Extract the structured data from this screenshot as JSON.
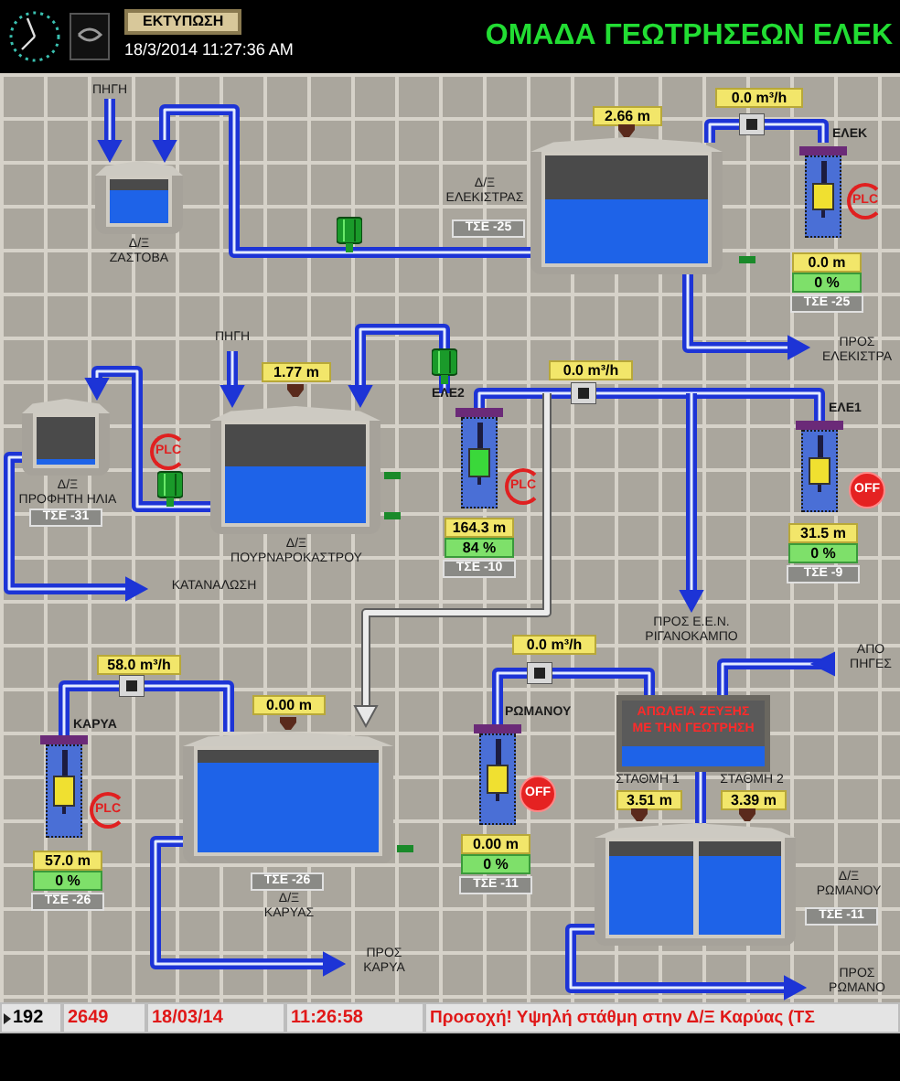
{
  "header": {
    "print_button": "ΕΚΤΥΠΩΣΗ",
    "datetime": "18/3/2014 11:27:36 AM",
    "title": "ΟΜΑΔΑ ΓΕΩΤΡΗΣΕΩΝ ΕΛΕΚ"
  },
  "tanks": [
    {
      "kind": "single",
      "label": "Δ/Ξ\nΖΑΣΤΟΒΑ",
      "level": 0.75
    },
    {
      "kind": "single",
      "label": "Δ/Ξ\nΕΛΕΚΙΣΤΡΑΣ",
      "reading": "2.66 m",
      "tag": "ΤΣΕ -25",
      "level": 0.6
    },
    {
      "kind": "single",
      "label": "Δ/Ξ\nΠΡΟΦΗΤΗ ΗΛΙΑ",
      "tag": "ΤΣΕ -31",
      "level": 0.12
    },
    {
      "kind": "single",
      "label": "Δ/Ξ\nΠΟΥΡΝΑΡΟΚΑΣΤΡΟΥ",
      "reading": "1.77 m",
      "level": 0.58
    },
    {
      "kind": "single",
      "label": "Δ/Ξ\nΚΑΡΥΑΣ",
      "reading": "0.00 m",
      "tag": "ΤΣΕ -26",
      "level": 0.88
    },
    {
      "kind": "split",
      "label": "Δ/Ξ\nΡΩΜΑΝΟΥ",
      "tag": "ΤΣΕ -11",
      "gauges": [
        {
          "label": "ΣΤΑΘΜΗ 1",
          "reading": "3.51 m",
          "level": 0.85
        },
        {
          "label": "ΣΤΑΘΜΗ 2",
          "reading": "3.39 m",
          "level": 0.85
        }
      ]
    }
  ],
  "pumps": [
    {
      "name": "ΕΛΕΚ",
      "running": false,
      "mode": {
        "kind": "auto",
        "label": "PLC"
      },
      "depth": "0.0 m",
      "output": "0 %",
      "tag": "ΤΣΕ -25"
    },
    {
      "name": "ΕΛΕ2",
      "running": true,
      "mode": {
        "kind": "auto",
        "label": "PLC"
      },
      "depth": "164.3 m",
      "output": "84 %",
      "tag": "ΤΣΕ -10"
    },
    {
      "name": "ΕΛΕ1",
      "running": false,
      "mode": {
        "kind": "off",
        "label": "OFF"
      },
      "depth": "31.5 m",
      "output": "0 %",
      "tag": "ΤΣΕ -9"
    },
    {
      "name": "ΚΑΡΥΑ",
      "running": false,
      "mode": {
        "kind": "auto",
        "label": "PLC"
      },
      "depth": "57.0 m",
      "output": "0 %",
      "tag": "ΤΣΕ -26"
    },
    {
      "name": "ΡΩΜΑΝΟΥ",
      "running": false,
      "mode": {
        "kind": "off",
        "label": "OFF"
      },
      "depth": "0.00 m",
      "output": "0 %",
      "tag": "ΤΣΕ -11"
    }
  ],
  "flow_meters": [
    {
      "reading": "0.0 m³/h"
    },
    {
      "reading": "0.0 m³/h"
    },
    {
      "reading": "58.0 m³/h"
    },
    {
      "reading": "0.0 m³/h"
    }
  ],
  "valve_mode": {
    "kind": "auto",
    "label": "PLC"
  },
  "alarm": {
    "text": "ΑΠΩΛΕΙΑ ΖΕΥΞΗΣ\nΜΕ ΤΗΝ ΓΕΩΤΡΗΣΗ",
    "level": 0.3
  },
  "flow_labels": [
    "ΠΗΓΗ",
    "ΠΗΓΗ",
    "ΠΡΟΣ\nΕΛΕΚΙΣΤΡΑ",
    "ΚΑΤΑΝΑΛΩΣΗ",
    "ΠΡΟΣ Ε.Ε.Ν.\nΡΙΓΑΝΟΚΑΜΠΟ",
    "ΑΠΟ\nΠΗΓΕΣ",
    "ΠΡΟΣ\nΚΑΡΥΑ",
    "ΠΡΟΣ\nΡΩΜΑΝΟ"
  ],
  "status_bar": {
    "record": "192",
    "code": "2649",
    "date": "18/03/14",
    "time": "11:26:58",
    "message": "Προσοχή! Υψηλή στάθμη στην Δ/Ξ Καρύας (ΤΣ"
  }
}
